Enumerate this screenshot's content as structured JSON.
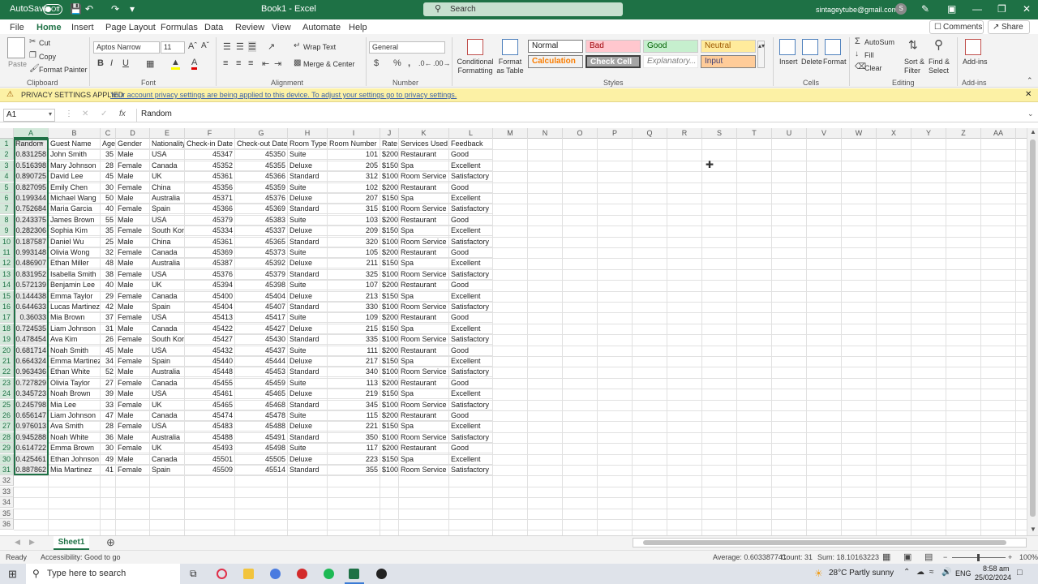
{
  "titlebar": {
    "autosave_label": "AutoSave",
    "autosave_state": "Off",
    "file_name": "Book1 - Excel",
    "search_placeholder": "Search",
    "user_email": "sintageytube@gmail.com",
    "avatar_letter": "S"
  },
  "menu": {
    "items": [
      "File",
      "Home",
      "Insert",
      "Page Layout",
      "Formulas",
      "Data",
      "Review",
      "View",
      "Automate",
      "Help"
    ],
    "active": "Home",
    "comments": "Comments",
    "share": "Share"
  },
  "ribbon": {
    "clipboard": {
      "label": "Clipboard",
      "paste": "Paste",
      "cut": "Cut",
      "copy": "Copy",
      "format_painter": "Format Painter"
    },
    "font": {
      "label": "Font",
      "name": "Aptos Narrow",
      "size": "11",
      "bold": "B",
      "italic": "I",
      "underline": "U"
    },
    "alignment": {
      "label": "Alignment",
      "wrap": "Wrap Text",
      "merge": "Merge & Center"
    },
    "number": {
      "label": "Number",
      "format": "General",
      "currency": "$",
      "percent": "%"
    },
    "styles": {
      "label": "Styles",
      "conditional": "Conditional Formatting",
      "format_table": "Format as Table",
      "normal": "Normal",
      "bad": "Bad",
      "good": "Good",
      "neutral": "Neutral",
      "calculation": "Calculation",
      "check_cell": "Check Cell",
      "explanatory": "Explanatory...",
      "input": "Input",
      "colors": {
        "bad_bg": "#ffc7ce",
        "bad_fg": "#9c0006",
        "good_bg": "#c6efce",
        "good_fg": "#006100",
        "neutral_bg": "#ffeb9c",
        "neutral_fg": "#9c5700",
        "calc_bg": "#f2f2f2",
        "calc_fg": "#fa7d00",
        "check_bg": "#a5a5a5",
        "input_bg": "#ffcc99",
        "input_fg": "#3f3f76"
      }
    },
    "cells": {
      "label": "Cells",
      "insert": "Insert",
      "delete": "Delete",
      "format": "Format"
    },
    "editing": {
      "label": "Editing",
      "autosum": "AutoSum",
      "fill": "Fill",
      "clear": "Clear",
      "sort": "Sort & Filter",
      "find": "Find & Select"
    },
    "addins": {
      "label": "Add-ins",
      "name": "Add-ins"
    }
  },
  "privacy": {
    "title": "PRIVACY SETTINGS APPLIED",
    "message": "Your account privacy settings are being applied to this device. To adjust your settings go to privacy settings."
  },
  "formula": {
    "name_box": "A1",
    "content": "Random",
    "fx": "fx"
  },
  "sheet": {
    "columns": [
      "A",
      "B",
      "C",
      "D",
      "E",
      "F",
      "G",
      "H",
      "I",
      "J",
      "K",
      "L",
      "M",
      "N",
      "O",
      "P",
      "Q",
      "R",
      "S",
      "T",
      "U",
      "V",
      "W",
      "X",
      "Y",
      "Z",
      "AA"
    ],
    "headers": [
      "Random",
      "Guest Name",
      "Age",
      "Gender",
      "Nationality",
      "Check-in Date",
      "Check-out Date",
      "Room Type",
      "Room Number",
      "Rate",
      "Services Used",
      "Feedback"
    ],
    "rows": [
      [
        "0.831258",
        "John Smith",
        "35",
        "Male",
        "USA",
        "45347",
        "45350",
        "Suite",
        "101",
        "$200",
        "Restaurant",
        "Good"
      ],
      [
        "0.516398",
        "Mary Johnson",
        "28",
        "Female",
        "Canada",
        "45352",
        "45355",
        "Deluxe",
        "205",
        "$150",
        "Spa",
        "Excellent"
      ],
      [
        "0.890725",
        "David Lee",
        "45",
        "Male",
        "UK",
        "45361",
        "45366",
        "Standard",
        "312",
        "$100",
        "Room Service",
        "Satisfactory"
      ],
      [
        "0.827095",
        "Emily Chen",
        "30",
        "Female",
        "China",
        "45356",
        "45359",
        "Suite",
        "102",
        "$200",
        "Restaurant",
        "Good"
      ],
      [
        "0.199344",
        "Michael Wang",
        "50",
        "Male",
        "Australia",
        "45371",
        "45376",
        "Deluxe",
        "207",
        "$150",
        "Spa",
        "Excellent"
      ],
      [
        "0.752684",
        "Maria Garcia",
        "40",
        "Female",
        "Spain",
        "45366",
        "45369",
        "Standard",
        "315",
        "$100",
        "Room Service",
        "Satisfactory"
      ],
      [
        "0.243375",
        "James Brown",
        "55",
        "Male",
        "USA",
        "45379",
        "45383",
        "Suite",
        "103",
        "$200",
        "Restaurant",
        "Good"
      ],
      [
        "0.282306",
        "Sophia Kim",
        "35",
        "Female",
        "South Korea",
        "45334",
        "45337",
        "Deluxe",
        "209",
        "$150",
        "Spa",
        "Excellent"
      ],
      [
        "0.187587",
        "Daniel Wu",
        "25",
        "Male",
        "China",
        "45361",
        "45365",
        "Standard",
        "320",
        "$100",
        "Room Service",
        "Satisfactory"
      ],
      [
        "0.993148",
        "Olivia Wong",
        "32",
        "Female",
        "Canada",
        "45369",
        "45373",
        "Suite",
        "105",
        "$200",
        "Restaurant",
        "Good"
      ],
      [
        "0.486907",
        "Ethan Miller",
        "48",
        "Male",
        "Australia",
        "45387",
        "45392",
        "Deluxe",
        "211",
        "$150",
        "Spa",
        "Excellent"
      ],
      [
        "0.831952",
        "Isabella Smith",
        "38",
        "Female",
        "USA",
        "45376",
        "45379",
        "Standard",
        "325",
        "$100",
        "Room Service",
        "Satisfactory"
      ],
      [
        "0.572139",
        "Benjamin Lee",
        "40",
        "Male",
        "UK",
        "45394",
        "45398",
        "Suite",
        "107",
        "$200",
        "Restaurant",
        "Good"
      ],
      [
        "0.144438",
        "Emma Taylor",
        "29",
        "Female",
        "Canada",
        "45400",
        "45404",
        "Deluxe",
        "213",
        "$150",
        "Spa",
        "Excellent"
      ],
      [
        "0.644633",
        "Lucas Martinez",
        "42",
        "Male",
        "Spain",
        "45404",
        "45407",
        "Standard",
        "330",
        "$100",
        "Room Service",
        "Satisfactory"
      ],
      [
        "0.36033",
        "Mia Brown",
        "37",
        "Female",
        "USA",
        "45413",
        "45417",
        "Suite",
        "109",
        "$200",
        "Restaurant",
        "Good"
      ],
      [
        "0.724535",
        "Liam Johnson",
        "31",
        "Male",
        "Canada",
        "45422",
        "45427",
        "Deluxe",
        "215",
        "$150",
        "Spa",
        "Excellent"
      ],
      [
        "0.478454",
        "Ava Kim",
        "26",
        "Female",
        "South Korea",
        "45427",
        "45430",
        "Standard",
        "335",
        "$100",
        "Room Service",
        "Satisfactory"
      ],
      [
        "0.681714",
        "Noah Smith",
        "45",
        "Male",
        "USA",
        "45432",
        "45437",
        "Suite",
        "111",
        "$200",
        "Restaurant",
        "Good"
      ],
      [
        "0.664324",
        "Emma Martinez",
        "34",
        "Female",
        "Spain",
        "45440",
        "45444",
        "Deluxe",
        "217",
        "$150",
        "Spa",
        "Excellent"
      ],
      [
        "0.963436",
        "Ethan White",
        "52",
        "Male",
        "Australia",
        "45448",
        "45453",
        "Standard",
        "340",
        "$100",
        "Room Service",
        "Satisfactory"
      ],
      [
        "0.727829",
        "Olivia Taylor",
        "27",
        "Female",
        "Canada",
        "45455",
        "45459",
        "Suite",
        "113",
        "$200",
        "Restaurant",
        "Good"
      ],
      [
        "0.345723",
        "Noah Brown",
        "39",
        "Male",
        "USA",
        "45461",
        "45465",
        "Deluxe",
        "219",
        "$150",
        "Spa",
        "Excellent"
      ],
      [
        "0.245798",
        "Mia Lee",
        "33",
        "Female",
        "UK",
        "45465",
        "45468",
        "Standard",
        "345",
        "$100",
        "Room Service",
        "Satisfactory"
      ],
      [
        "0.656147",
        "Liam Johnson",
        "47",
        "Male",
        "Canada",
        "45474",
        "45478",
        "Suite",
        "115",
        "$200",
        "Restaurant",
        "Good"
      ],
      [
        "0.976013",
        "Ava Smith",
        "28",
        "Female",
        "USA",
        "45483",
        "45488",
        "Deluxe",
        "221",
        "$150",
        "Spa",
        "Excellent"
      ],
      [
        "0.945288",
        "Noah White",
        "36",
        "Male",
        "Australia",
        "45488",
        "45491",
        "Standard",
        "350",
        "$100",
        "Room Service",
        "Satisfactory"
      ],
      [
        "0.614722",
        "Emma Brown",
        "30",
        "Female",
        "UK",
        "45493",
        "45498",
        "Suite",
        "117",
        "$200",
        "Restaurant",
        "Good"
      ],
      [
        "0.425461",
        "Ethan Johnson",
        "49",
        "Male",
        "Canada",
        "45501",
        "45505",
        "Deluxe",
        "223",
        "$150",
        "Spa",
        "Excellent"
      ],
      [
        "0.887862",
        "Mia Martinez",
        "41",
        "Female",
        "Spain",
        "45509",
        "45514",
        "Standard",
        "355",
        "$100",
        "Room Service",
        "Satisfactory"
      ]
    ],
    "tab_name": "Sheet1"
  },
  "status": {
    "ready": "Ready",
    "accessibility": "Accessibility: Good to go",
    "average": "Average: 0.603387741",
    "count": "Count: 31",
    "sum": "Sum: 18.10163223",
    "zoom": "100%"
  },
  "taskbar": {
    "search_placeholder": "Type here to search",
    "weather": "28°C  Partly sunny",
    "lang": "ENG",
    "time": "8:58 am",
    "date": "25/02/2024"
  }
}
